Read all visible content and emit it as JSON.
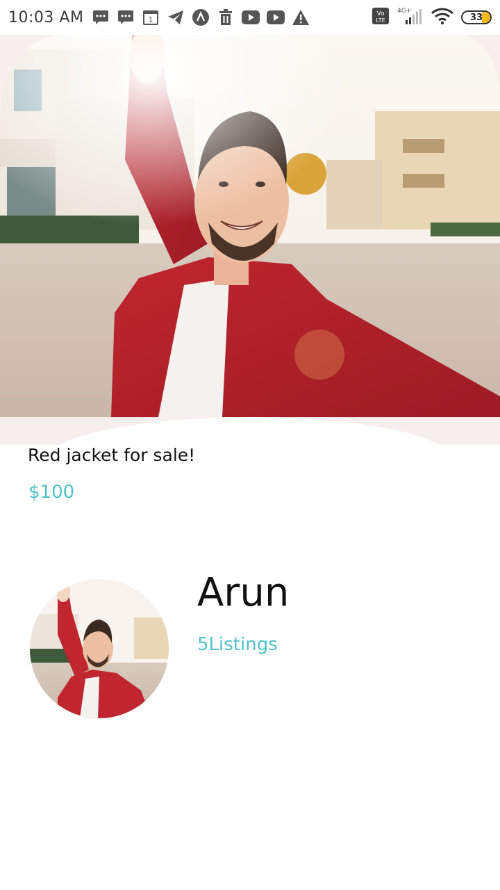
{
  "status_bar": {
    "time": "10:03 AM",
    "network": "4G+",
    "volte": "Vo LTE",
    "battery": "33",
    "notification_icons": [
      "message-icon",
      "message-icon",
      "calendar-icon",
      "telegram-icon",
      "arc-icon",
      "trash-icon",
      "youtube-icon",
      "youtube-icon",
      "warning-icon"
    ]
  },
  "listing": {
    "title": "Red jacket for sale!",
    "price": "$100"
  },
  "seller": {
    "name": "Arun",
    "listings": "5Listings"
  },
  "colors": {
    "accent": "#4fc3c7",
    "jacket": "#c0262f",
    "hero_bg": "#f6efee"
  }
}
